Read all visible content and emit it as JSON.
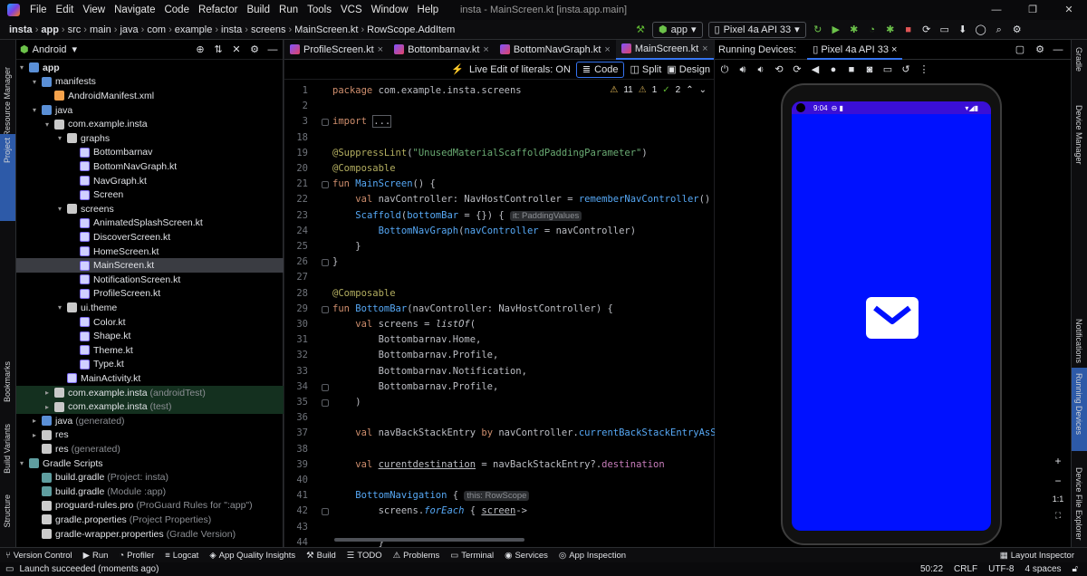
{
  "menu": {
    "items": [
      "File",
      "Edit",
      "View",
      "Navigate",
      "Code",
      "Refactor",
      "Build",
      "Run",
      "Tools",
      "VCS",
      "Window",
      "Help"
    ],
    "title": "insta - MainScreen.kt [insta.app.main]"
  },
  "nav": {
    "crumbs": [
      "insta",
      "app",
      "src",
      "main",
      "java",
      "com",
      "example",
      "insta",
      "screens",
      "MainScreen.kt",
      "RowScope.AddItem"
    ],
    "run_config": "app",
    "device": "Pixel 4a API 33"
  },
  "left_strip": {
    "resource_manager": "Resource Manager",
    "project": "Project",
    "bookmarks": "Bookmarks",
    "build_variants": "Build Variants",
    "structure": "Structure"
  },
  "project": {
    "view": "Android",
    "tree": [
      {
        "label": "app",
        "icon": "folderb",
        "indent": 0,
        "arrow": "▾",
        "bold": true
      },
      {
        "label": "manifests",
        "icon": "folderb",
        "indent": 1,
        "arrow": "▾"
      },
      {
        "label": "AndroidManifest.xml",
        "icon": "xml",
        "indent": 2,
        "arrow": ""
      },
      {
        "label": "java",
        "icon": "folderb",
        "indent": 1,
        "arrow": "▾"
      },
      {
        "label": "com.example.insta",
        "icon": "folder",
        "indent": 2,
        "arrow": "▾"
      },
      {
        "label": "graphs",
        "icon": "folder",
        "indent": 3,
        "arrow": "▾"
      },
      {
        "label": "Bottombarnav",
        "icon": "kt",
        "indent": 4,
        "arrow": ""
      },
      {
        "label": "BottomNavGraph.kt",
        "icon": "kt",
        "indent": 4,
        "arrow": ""
      },
      {
        "label": "NavGraph.kt",
        "icon": "kt",
        "indent": 4,
        "arrow": ""
      },
      {
        "label": "Screen",
        "icon": "kt",
        "indent": 4,
        "arrow": ""
      },
      {
        "label": "screens",
        "icon": "folder",
        "indent": 3,
        "arrow": "▾"
      },
      {
        "label": "AnimatedSplashScreen.kt",
        "icon": "kt",
        "indent": 4,
        "arrow": ""
      },
      {
        "label": "DiscoverScreen.kt",
        "icon": "kt",
        "indent": 4,
        "arrow": ""
      },
      {
        "label": "HomeScreen.kt",
        "icon": "kt",
        "indent": 4,
        "arrow": ""
      },
      {
        "label": "MainScreen.kt",
        "icon": "kt",
        "indent": 4,
        "arrow": "",
        "sel": true
      },
      {
        "label": "NotificationScreen.kt",
        "icon": "kt",
        "indent": 4,
        "arrow": ""
      },
      {
        "label": "ProfileScreen.kt",
        "icon": "kt",
        "indent": 4,
        "arrow": ""
      },
      {
        "label": "ui.theme",
        "icon": "folder",
        "indent": 3,
        "arrow": "▾"
      },
      {
        "label": "Color.kt",
        "icon": "kt",
        "indent": 4,
        "arrow": ""
      },
      {
        "label": "Shape.kt",
        "icon": "kt",
        "indent": 4,
        "arrow": ""
      },
      {
        "label": "Theme.kt",
        "icon": "kt",
        "indent": 4,
        "arrow": ""
      },
      {
        "label": "Type.kt",
        "icon": "kt",
        "indent": 4,
        "arrow": ""
      },
      {
        "label": "MainActivity.kt",
        "icon": "kt",
        "indent": 3,
        "arrow": ""
      },
      {
        "label": "com.example.insta",
        "icon": "folder",
        "indent": 2,
        "arrow": "▸",
        "note": "(androidTest)",
        "green": true
      },
      {
        "label": "com.example.insta",
        "icon": "folder",
        "indent": 2,
        "arrow": "▸",
        "note": "(test)",
        "green": true
      },
      {
        "label": "java",
        "icon": "folderb",
        "indent": 1,
        "arrow": "▸",
        "note": "(generated)"
      },
      {
        "label": "res",
        "icon": "folder",
        "indent": 1,
        "arrow": "▸"
      },
      {
        "label": "res",
        "icon": "folder",
        "indent": 1,
        "arrow": "",
        "note": "(generated)"
      },
      {
        "label": "Gradle Scripts",
        "icon": "gr",
        "indent": 0,
        "arrow": "▾"
      },
      {
        "label": "build.gradle",
        "icon": "gr",
        "indent": 1,
        "arrow": "",
        "note": "(Project: insta)"
      },
      {
        "label": "build.gradle",
        "icon": "gr",
        "indent": 1,
        "arrow": "",
        "note": "(Module :app)"
      },
      {
        "label": "proguard-rules.pro",
        "icon": "pro",
        "indent": 1,
        "arrow": "",
        "note": "(ProGuard Rules for \":app\")"
      },
      {
        "label": "gradle.properties",
        "icon": "pro",
        "indent": 1,
        "arrow": "",
        "note": "(Project Properties)"
      },
      {
        "label": "gradle-wrapper.properties",
        "icon": "pro",
        "indent": 1,
        "arrow": "",
        "note": "(Gradle Version)"
      }
    ]
  },
  "editor": {
    "tabs": [
      "ProfileScreen.kt",
      "Bottombarnav.kt",
      "BottomNavGraph.kt",
      "MainScreen.kt"
    ],
    "active_tab": "MainScreen.kt",
    "toolbar": {
      "live_edit": "Live Edit of literals: ON",
      "code": "Code",
      "split": "Split",
      "design": "Design"
    },
    "inspections": {
      "warnings": "11",
      "weak": "1",
      "ok": "2"
    }
  },
  "code_lines": [
    {
      "n": "1",
      "html": "<span class='kw'>package</span> com.example.insta.screens"
    },
    {
      "n": "2",
      "html": ""
    },
    {
      "n": "3",
      "html": "<span class='kw'>import</span> <span style='border:1px solid #5a5d63'>...</span>"
    },
    {
      "n": "18",
      "html": ""
    },
    {
      "n": "19",
      "html": "<span class='an'>@SuppressLint</span>(<span class='str'>\"UnusedMaterialScaffoldPaddingParameter\"</span>)"
    },
    {
      "n": "20",
      "html": "<span class='an'>@Composable</span>"
    },
    {
      "n": "21",
      "html": "<span class='kw'>fun</span> <span class='fn'>MainScreen</span>() {"
    },
    {
      "n": "22",
      "html": "    <span class='kw'>val</span> navController: NavHostController = <span class='fn'>rememberNavController</span>()"
    },
    {
      "n": "23",
      "html": "    <span class='fn'>Scaffold</span>(<span class='nm'>bottomBar</span> = {}) { <span class='hint'>it: PaddingValues</span>"
    },
    {
      "n": "24",
      "html": "        <span class='fn'>BottomNavGraph</span>(<span class='nm'>navController</span> = navController)"
    },
    {
      "n": "25",
      "html": "    }"
    },
    {
      "n": "26",
      "html": "}"
    },
    {
      "n": "27",
      "html": ""
    },
    {
      "n": "28",
      "html": "<span class='an'>@Composable</span>"
    },
    {
      "n": "29",
      "html": "<span class='kw'>fun</span> <span class='fn'>BottomBar</span>(navController: NavHostController) {"
    },
    {
      "n": "30",
      "html": "    <span class='kw'>val</span> screens = <span class='it'>listOf</span>("
    },
    {
      "n": "31",
      "html": "        Bottombarnav.Home,"
    },
    {
      "n": "32",
      "html": "        Bottombarnav.Profile,"
    },
    {
      "n": "33",
      "html": "        Bottombarnav.Notification,"
    },
    {
      "n": "34",
      "html": "        Bottombarnav.Profile,"
    },
    {
      "n": "35",
      "html": "    )"
    },
    {
      "n": "36",
      "html": ""
    },
    {
      "n": "37",
      "html": "    <span class='kw'>val</span> navBackStackEntry <span class='kw'>by</span> navController.<span class='fn'>currentBackStackEntryAsS</span>"
    },
    {
      "n": "38",
      "html": ""
    },
    {
      "n": "39",
      "html": "    <span class='kw'>val</span> <span style='text-decoration:underline'>curentdestination</span> = navBackStackEntry?.<span class='pr'>destination</span>"
    },
    {
      "n": "40",
      "html": ""
    },
    {
      "n": "41",
      "html": "    <span class='fn'>BottomNavigation</span> { <span class='hint'>this: RowScope</span>"
    },
    {
      "n": "42",
      "html": "        screens.<span class='it fn'>forEach</span> { <span style='text-decoration:underline'>screen</span>->"
    },
    {
      "n": "43",
      "html": ""
    },
    {
      "n": "44",
      "html": "        }"
    }
  ],
  "devices": {
    "panel": "Running Devices:",
    "tab": "Pixel 4a API 33",
    "time": "9:04",
    "screen_bg": "#0011ff",
    "status_bg": "#3a0fd6"
  },
  "right_strip": {
    "gradle": "Gradle",
    "device_manager": "Device Manager",
    "notifications": "Notifications",
    "running_devices": "Running Devices",
    "device_file_explorer": "Device File Explorer"
  },
  "bottom": {
    "items": [
      "Version Control",
      "Run",
      "Profiler",
      "Logcat",
      "App Quality Insights",
      "Build",
      "TODO",
      "Problems",
      "Terminal",
      "Services",
      "App Inspection"
    ],
    "layout_inspector": "Layout Inspector"
  },
  "status": {
    "message": "Launch succeeded (moments ago)",
    "position": "50:22",
    "line_sep": "CRLF",
    "encoding": "UTF-8",
    "indent": "4 spaces"
  },
  "zoom": {
    "plus": "+",
    "minus": "−",
    "ratio": "1:1"
  }
}
